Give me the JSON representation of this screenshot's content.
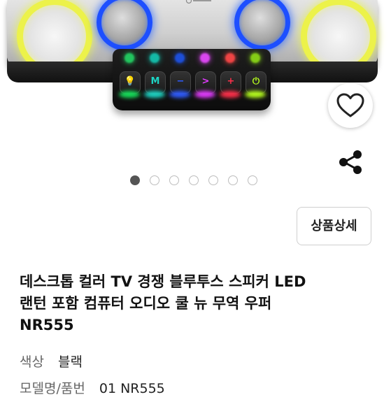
{
  "product": {
    "images": {
      "count": 7,
      "active_index": 0
    },
    "actions": {
      "detail_label": "상품상세"
    },
    "title_lines": [
      "데스크톱 컬러 TV 경쟁 블루투스 스피커 LED",
      "랜턴 포함 컴퓨터 오디오 쿨 뉴 무역 우퍼",
      "NR555"
    ],
    "attributes": [
      {
        "label": "색상",
        "value": "블랙"
      },
      {
        "label": "모델명/품번",
        "value": "01 NR555"
      }
    ]
  },
  "speaker_controls": [
    "💡",
    "M",
    "−",
    ">",
    "+",
    "⏻"
  ],
  "colors": {
    "led": [
      "#22c55e",
      "#14b8a6",
      "#1d4ed8",
      "#d946ef",
      "#ef4444",
      "#84cc16"
    ],
    "glow": [
      "#16e05a",
      "#1dd4c4",
      "#2f5cff",
      "#e23bff",
      "#ff2f4a",
      "#b7ff1d"
    ],
    "dot_active": "#555555",
    "dot_inactive": "#bdbdbd"
  },
  "icons": {
    "wishlist": "heart-icon",
    "share": "share-icon"
  }
}
